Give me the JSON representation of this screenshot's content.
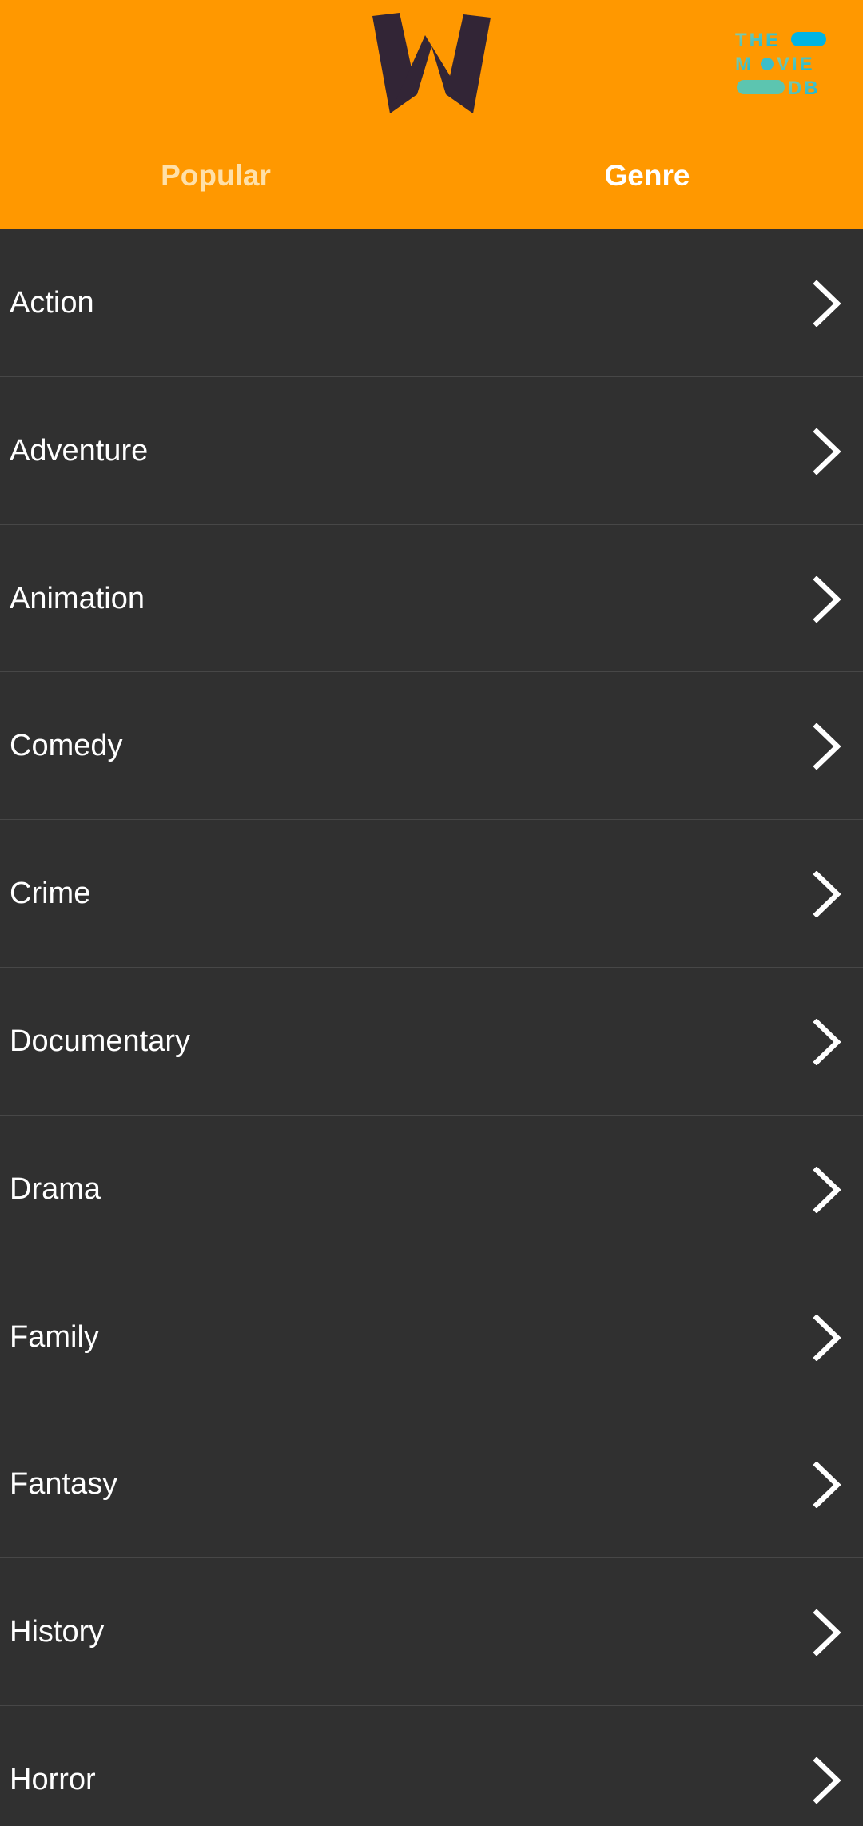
{
  "header": {
    "app_logo_icon": "w-logo-icon",
    "tmdb_logo_icon": "the-movie-db-logo-icon",
    "tmdb_logo_text": [
      "THE",
      "MOVIE",
      "DB"
    ],
    "background_color": "#FF9800",
    "logo_color": "#322536"
  },
  "tabs": [
    {
      "label": "Popular",
      "selected": false
    },
    {
      "label": "Genre",
      "selected": true
    }
  ],
  "genres": [
    {
      "label": "Action"
    },
    {
      "label": "Adventure"
    },
    {
      "label": "Animation"
    },
    {
      "label": "Comedy"
    },
    {
      "label": "Crime"
    },
    {
      "label": "Documentary"
    },
    {
      "label": "Drama"
    },
    {
      "label": "Family"
    },
    {
      "label": "Fantasy"
    },
    {
      "label": "History"
    },
    {
      "label": "Horror"
    }
  ],
  "list_item_icon": "chevron-right-icon",
  "list_background_color": "#303030"
}
